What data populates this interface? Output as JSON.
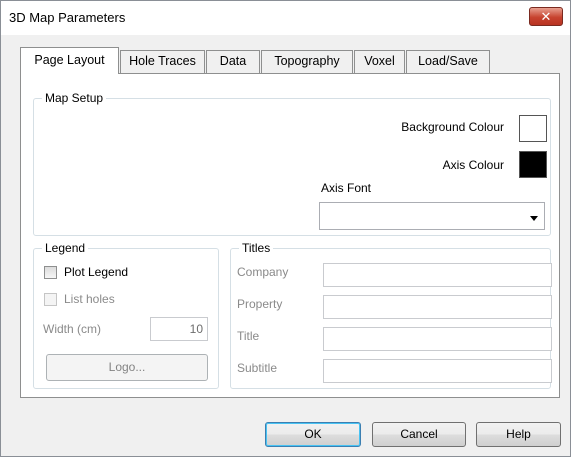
{
  "window": {
    "title": "3D Map Parameters",
    "close_glyph": "✕"
  },
  "tabs": [
    {
      "label": "Page Layout",
      "active": true
    },
    {
      "label": "Hole Traces",
      "active": false
    },
    {
      "label": "Data",
      "active": false
    },
    {
      "label": "Topography",
      "active": false
    },
    {
      "label": "Voxel",
      "active": false
    },
    {
      "label": "Load/Save",
      "active": false
    }
  ],
  "map_setup": {
    "group_label": "Map Setup",
    "background_colour_label": "Background Colour",
    "background_colour": "#ffffff",
    "axis_colour_label": "Axis Colour",
    "axis_colour": "#000000",
    "axis_font_label": "Axis Font",
    "axis_font_value": ""
  },
  "legend": {
    "group_label": "Legend",
    "plot_legend_label": "Plot Legend",
    "plot_legend_checked": false,
    "list_holes_label": "List holes",
    "list_holes_checked": false,
    "width_label": "Width (cm)",
    "width_value": "10",
    "logo_button": "Logo..."
  },
  "titles": {
    "group_label": "Titles",
    "fields": [
      {
        "label": "Company",
        "value": ""
      },
      {
        "label": "Property",
        "value": ""
      },
      {
        "label": "Title",
        "value": ""
      },
      {
        "label": "Subtitle",
        "value": ""
      }
    ]
  },
  "buttons": {
    "ok": "OK",
    "cancel": "Cancel",
    "help": "Help"
  }
}
